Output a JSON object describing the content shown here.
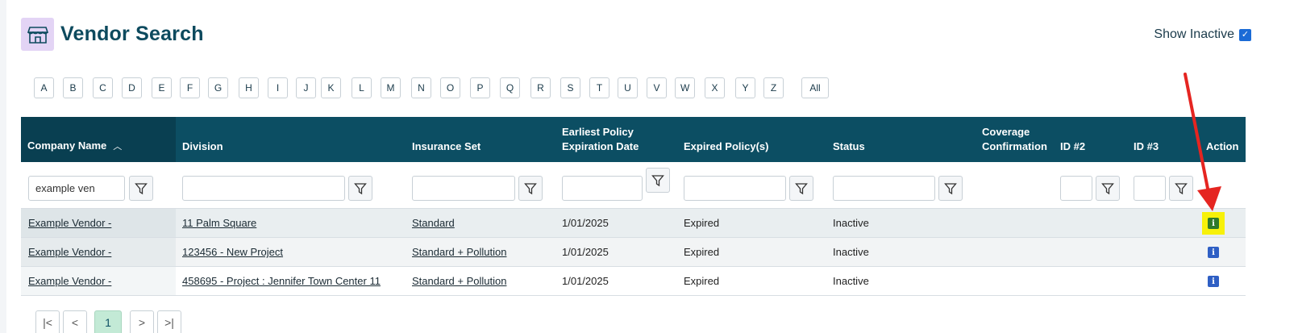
{
  "header": {
    "title": "Vendor Search",
    "icon": "storefront-icon",
    "accent_color": "#e3d4f5"
  },
  "show_inactive": {
    "label": "Show Inactive",
    "checked": true
  },
  "alphabet": [
    "A",
    "B",
    "C",
    "D",
    "E",
    "F",
    "G",
    "H",
    "I",
    "J",
    "K",
    "L",
    "M",
    "N",
    "O",
    "P",
    "Q",
    "R",
    "S",
    "T",
    "U",
    "V",
    "W",
    "X",
    "Y",
    "Z",
    "All"
  ],
  "grid": {
    "header_color": "#0c4e63",
    "columns": {
      "company_name": "Company Name",
      "division": "Division",
      "insurance_set": "Insurance Set",
      "earliest_policy_line1": "Earliest Policy",
      "earliest_policy_line2": "Expiration Date",
      "expired_policies": "Expired Policy(s)",
      "status": "Status",
      "coverage_line1": "Coverage",
      "coverage_line2": "Confirmation",
      "id2": "ID #2",
      "id3": "ID #3",
      "action": "Action"
    },
    "filters": {
      "company_name": "example ven",
      "division": "",
      "insurance_set": "",
      "earliest_policy": "",
      "expired_policies": "",
      "status": "",
      "id2": "",
      "id3": ""
    },
    "rows": [
      {
        "company": "Example Vendor -",
        "division": "11 Palm Square",
        "insurance_set": "Standard",
        "earliest": "1/01/2025",
        "expired": "Expired",
        "status": "Inactive",
        "action_icon": "info-icon"
      },
      {
        "company": "Example Vendor -",
        "division": "123456 - New Project",
        "insurance_set": "Standard + Pollution",
        "earliest": "1/01/2025",
        "expired": "Expired",
        "status": "Inactive",
        "action_icon": "info-icon"
      },
      {
        "company": "Example Vendor -",
        "division": "458695 - Project : Jennifer Town Center 11",
        "insurance_set": "Standard + Pollution",
        "earliest": "1/01/2025",
        "expired": "Expired",
        "status": "Inactive",
        "action_icon": "info-icon"
      }
    ]
  },
  "pager": {
    "current_page": "1",
    "first": "|<",
    "prev": "<",
    "next": ">",
    "last": ">|"
  },
  "annotation": {
    "color": "#e52521",
    "highlight_color": "#f7f10a"
  }
}
